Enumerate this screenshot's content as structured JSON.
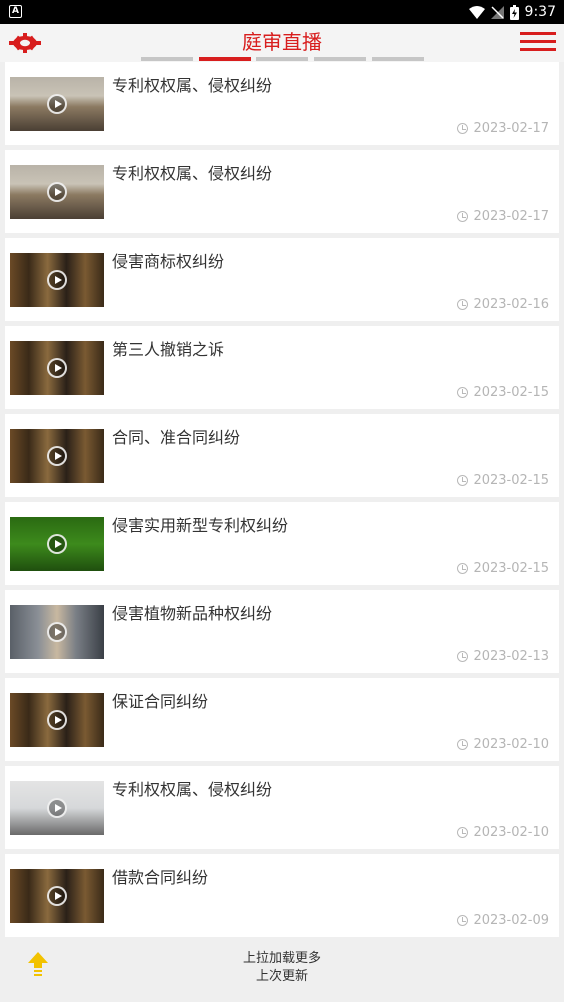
{
  "status_bar": {
    "app_badge": "A",
    "time": "9:37"
  },
  "header": {
    "title": "庭审直播"
  },
  "items": [
    {
      "title": "专利权权属、侵权纠纷",
      "date": "2023-02-17",
      "thumb": "courtroom-bright"
    },
    {
      "title": "专利权权属、侵权纠纷",
      "date": "2023-02-17",
      "thumb": "courtroom-bright"
    },
    {
      "title": "侵害商标权纠纷",
      "date": "2023-02-16",
      "thumb": "courtroom-dark"
    },
    {
      "title": "第三人撤销之诉",
      "date": "2023-02-15",
      "thumb": "courtroom-dark"
    },
    {
      "title": "合同、准合同纠纷",
      "date": "2023-02-15",
      "thumb": "courtroom-dark"
    },
    {
      "title": "侵害实用新型专利权纠纷",
      "date": "2023-02-15",
      "thumb": "courtroom-green"
    },
    {
      "title": "侵害植物新品种权纠纷",
      "date": "2023-02-13",
      "thumb": "video-grid"
    },
    {
      "title": "保证合同纠纷",
      "date": "2023-02-10",
      "thumb": "courtroom-dark"
    },
    {
      "title": "专利权权属、侵权纠纷",
      "date": "2023-02-10",
      "thumb": "room-light"
    },
    {
      "title": "借款合同纠纷",
      "date": "2023-02-09",
      "thumb": "courtroom-dark"
    }
  ],
  "footer": {
    "line1": "上拉加载更多",
    "line2": "上次更新"
  },
  "colors": {
    "accent": "#d81e1e",
    "date": "#b5b5b5"
  }
}
